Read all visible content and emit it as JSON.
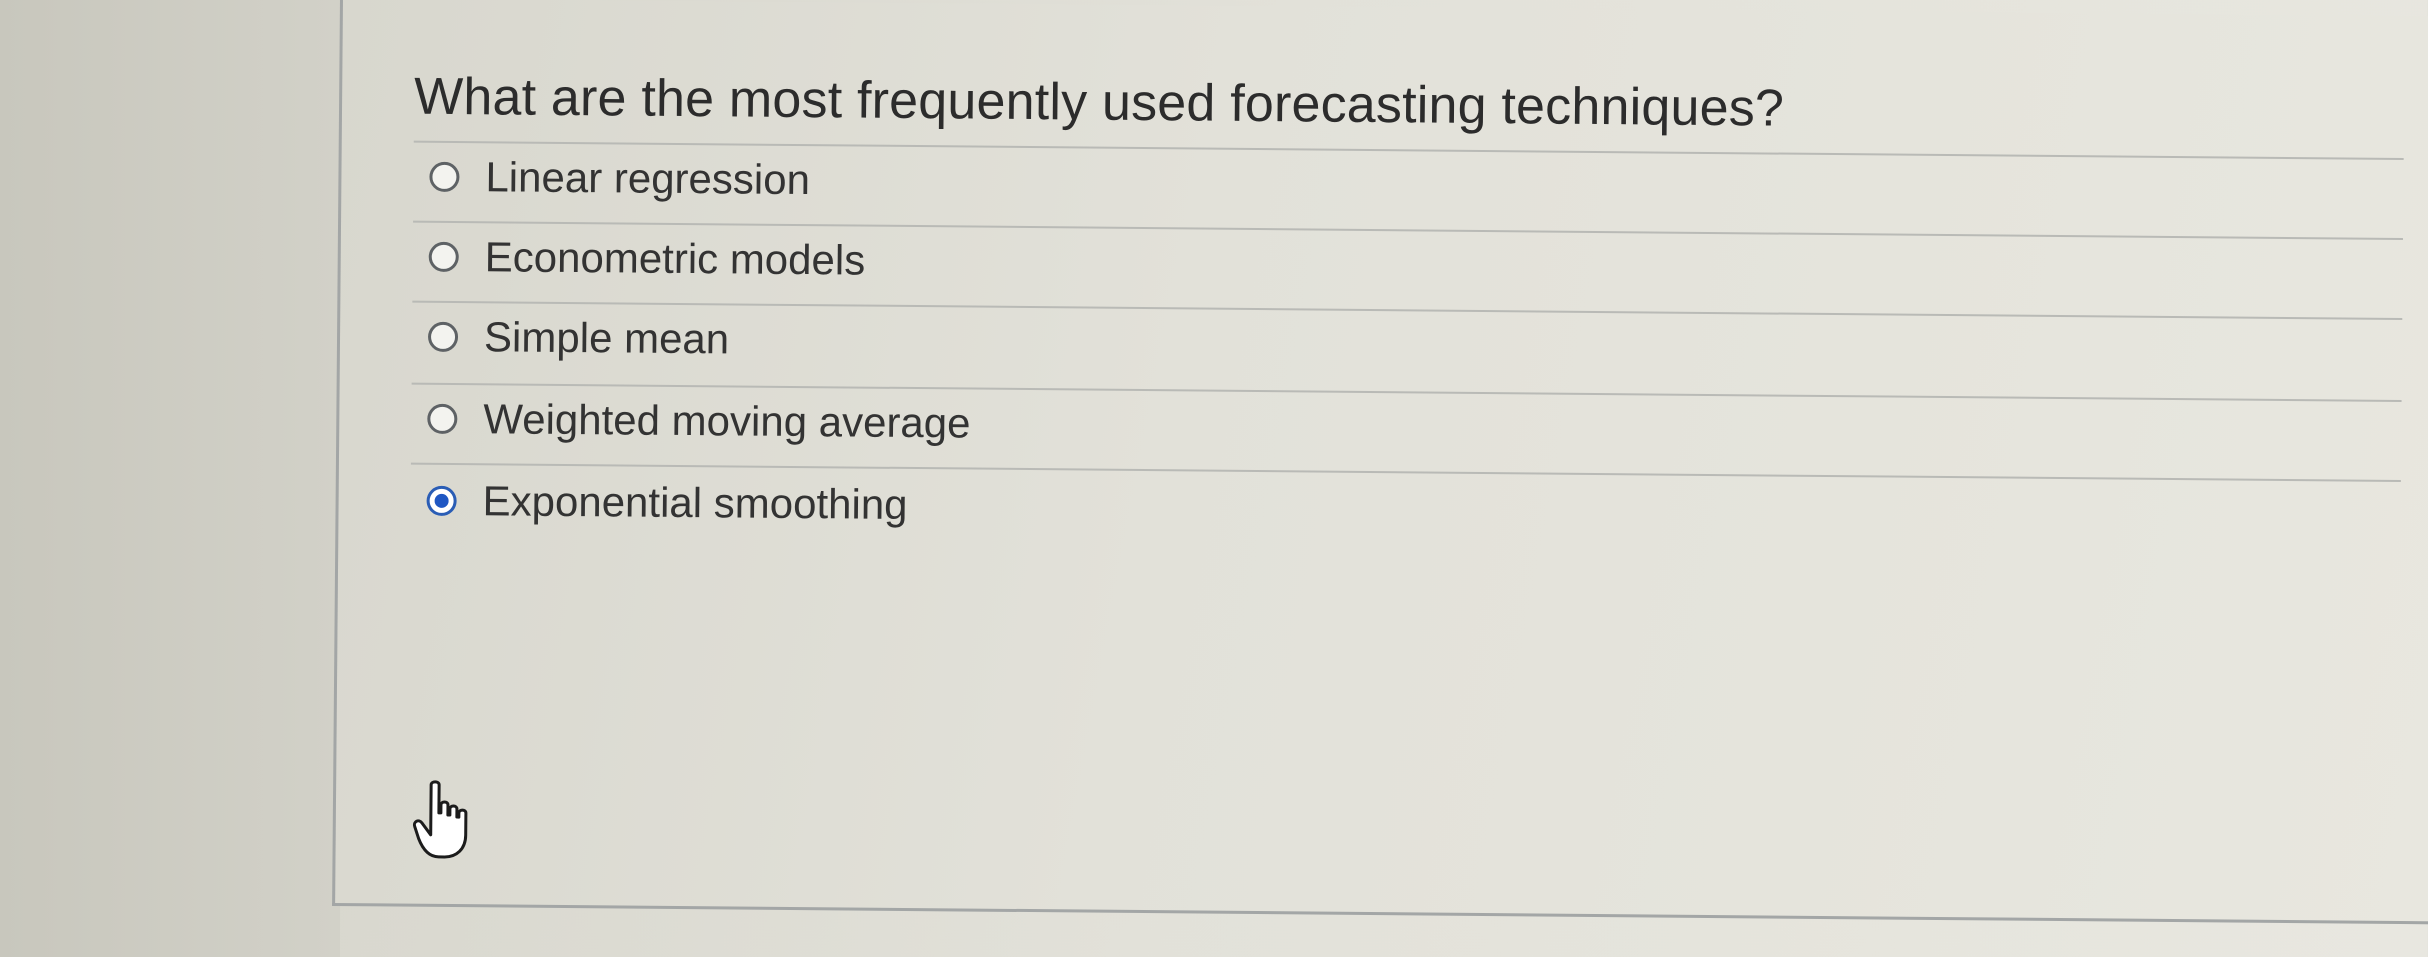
{
  "question": {
    "text": "What are the most frequently used forecasting techniques?"
  },
  "options": [
    {
      "label": "Linear regression",
      "selected": false
    },
    {
      "label": "Econometric models",
      "selected": false
    },
    {
      "label": "Simple mean",
      "selected": false
    },
    {
      "label": "Weighted moving average",
      "selected": false
    },
    {
      "label": "Exponential smoothing",
      "selected": true
    }
  ],
  "colors": {
    "radio_selected": "#1f57c3",
    "text": "#333333",
    "divider": "#b9bab6"
  },
  "icons": {
    "cursor": "hand-pointer-icon"
  }
}
